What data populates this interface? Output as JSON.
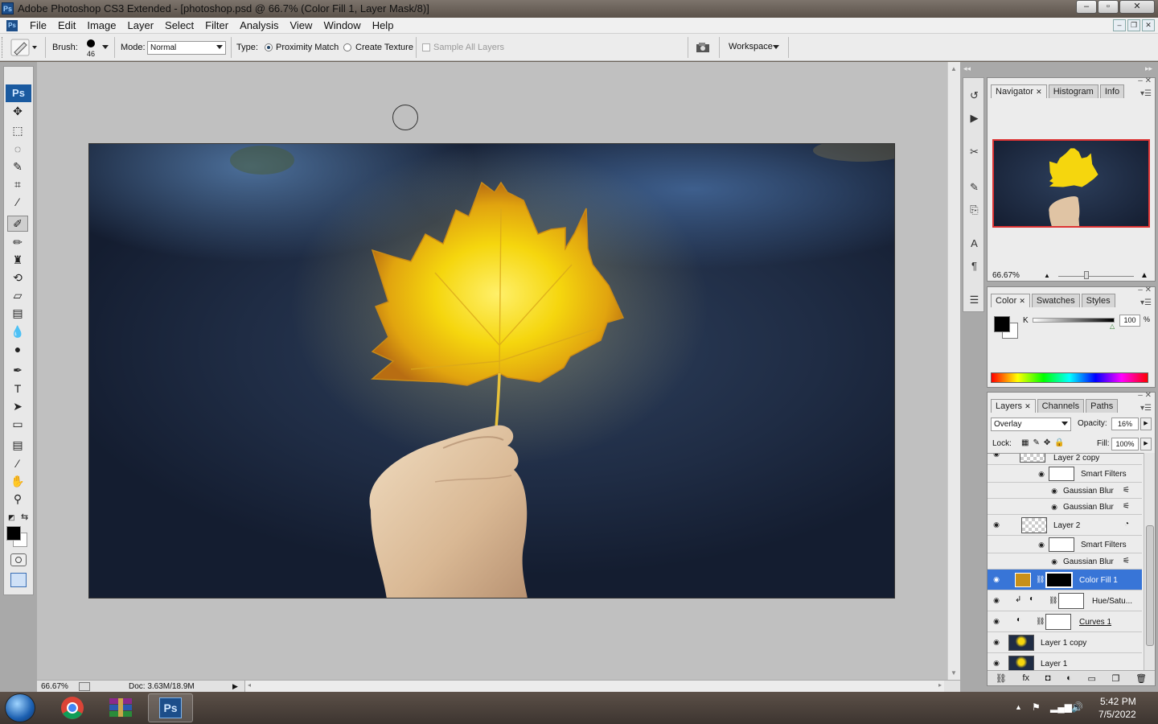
{
  "window": {
    "title": "Adobe Photoshop CS3 Extended - [photoshop.psd @ 66.7% (Color Fill 1, Layer Mask/8)]",
    "app_logo": "Ps",
    "controls": {
      "minimize": "–",
      "maximize": "▫",
      "close": "✕"
    }
  },
  "menubar": {
    "items": [
      "File",
      "Edit",
      "Image",
      "Layer",
      "Select",
      "Filter",
      "Analysis",
      "View",
      "Window",
      "Help"
    ],
    "doc_controls": {
      "minimize": "–",
      "restore": "❐",
      "close": "✕"
    }
  },
  "options": {
    "brush_label": "Brush:",
    "brush_size": "46",
    "mode_label": "Mode:",
    "mode_value": "Normal",
    "type_label": "Type:",
    "type_options": [
      "Proximity Match",
      "Create Texture"
    ],
    "sample_all": "Sample All Layers",
    "workspace": "Workspace"
  },
  "toolbox": {
    "logo": "Ps",
    "tools": [
      "move-tool",
      "marquee-tool",
      "lasso-tool",
      "quick-selection-tool",
      "crop-tool",
      "eyedropper-tool",
      "spot-healing-tool",
      "brush-tool",
      "clone-stamp-tool",
      "history-brush-tool",
      "eraser-tool",
      "gradient-tool",
      "blur-tool",
      "dodge-tool",
      "pen-tool",
      "type-tool",
      "path-selection-tool",
      "shape-tool",
      "notes-tool",
      "eyedropper2-tool",
      "hand-tool",
      "zoom-tool"
    ],
    "type_glyph": "T"
  },
  "status": {
    "zoom": "66.67%",
    "doc": "Doc: 3.63M/18.9M"
  },
  "navigator": {
    "tabs": [
      "Navigator",
      "Histogram",
      "Info"
    ],
    "zoom": "66.67%"
  },
  "color": {
    "tabs": [
      "Color",
      "Swatches",
      "Styles"
    ],
    "channel": "K",
    "value": "100",
    "unit": "%"
  },
  "layers": {
    "tabs": [
      "Layers",
      "Channels",
      "Paths"
    ],
    "blend_mode": "Overlay",
    "opacity_label": "Opacity:",
    "opacity": "16%",
    "lock_label": "Lock:",
    "fill_label": "Fill:",
    "fill": "100%",
    "rows": [
      {
        "name": "Layer 2 copy",
        "kind": "layer"
      },
      {
        "name": "Smart Filters",
        "kind": "smart"
      },
      {
        "name": "Gaussian Blur",
        "kind": "filter"
      },
      {
        "name": "Gaussian Blur",
        "kind": "filter"
      },
      {
        "name": "Layer 2",
        "kind": "layer"
      },
      {
        "name": "Smart Filters",
        "kind": "smart"
      },
      {
        "name": "Gaussian Blur",
        "kind": "filter"
      },
      {
        "name": "Color Fill 1",
        "kind": "fill",
        "active": true
      },
      {
        "name": "Hue/Satu...",
        "kind": "adjust"
      },
      {
        "name": "Curves 1",
        "kind": "adjust"
      },
      {
        "name": "Layer 1 copy",
        "kind": "image"
      },
      {
        "name": "Layer 1",
        "kind": "image"
      }
    ]
  },
  "taskbar": {
    "time": "5:42 PM",
    "date": "7/5/2022",
    "ps_label": "Ps"
  },
  "colors": {
    "accent_selected": "#3875d7",
    "fill_swatch": "#c8901a",
    "photo_bg": "#1f2c44",
    "leaf": "#f2d40a"
  }
}
